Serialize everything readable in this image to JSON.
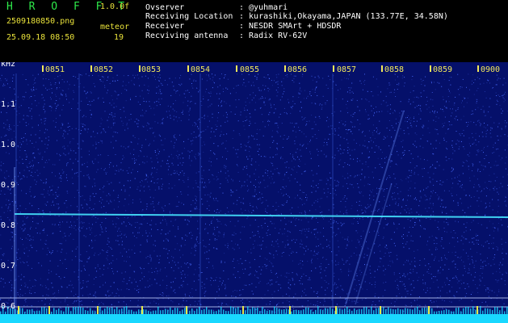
{
  "header": {
    "app_title": "H R O F F T",
    "version": "1.0.0f",
    "filename": "2509180850.png",
    "timestamp": "25.09.18 08:50",
    "meteor_label": "meteor",
    "meteor_count": "19",
    "info": [
      {
        "key": "Ovserver",
        "value": ": @yuhmari"
      },
      {
        "key": "Receiving Location",
        "value": ": kurashiki,Okayama,JAPAN (133.77E, 34.58N)"
      },
      {
        "key": "Receiver",
        "value": ": NESDR SMArt + HDSDR"
      },
      {
        "key": "Recviving antenna",
        "value": ": Radix RV-62V"
      }
    ]
  },
  "spectrogram": {
    "unit": "kHz",
    "time_labels": [
      "0851",
      "0852",
      "0853",
      "0854",
      "0855",
      "0856",
      "0857",
      "0858",
      "0859",
      "0900"
    ],
    "freq_labels": [
      "1.1",
      "1.0",
      "0.9",
      "0.8",
      "0.7",
      "0.6"
    ],
    "colors": {
      "background": "#05106a",
      "noise": "#4a6cff",
      "carrier": "#46e6ff",
      "tick": "#f2e85a",
      "floor": "#19d8ff"
    }
  }
}
